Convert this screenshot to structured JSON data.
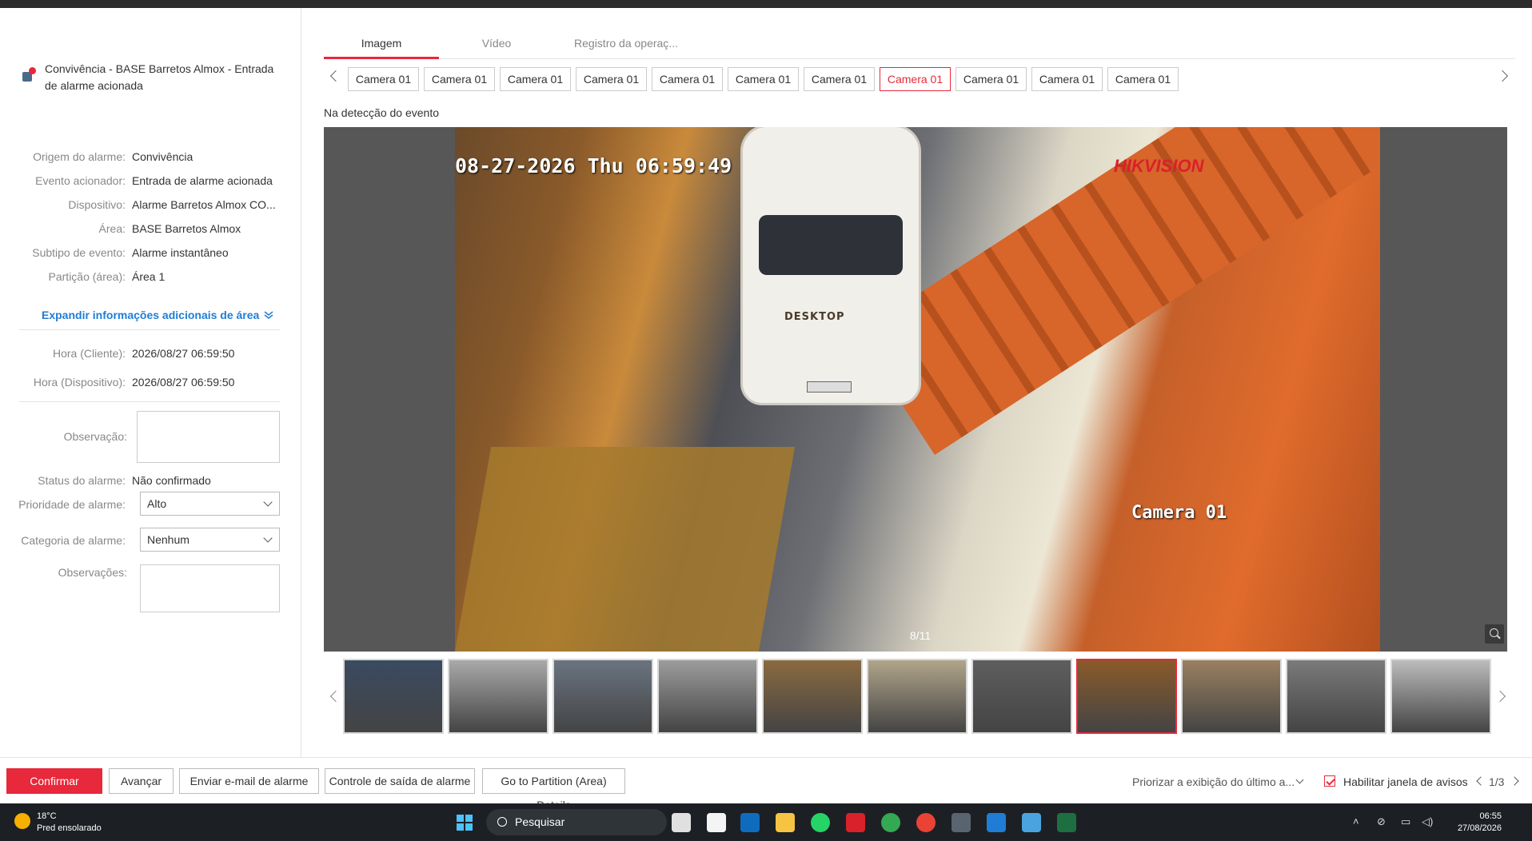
{
  "alarm": {
    "title": "Convivência - BASE Barretos Almox - Entrada de alarme acionada"
  },
  "details": [
    {
      "label": "Origem do alarme:",
      "value": "Convivência"
    },
    {
      "label": "Evento acionador:",
      "value": "Entrada de alarme acionada"
    },
    {
      "label": "Dispositivo:",
      "value": "Alarme Barretos Almox CO..."
    },
    {
      "label": "Área:",
      "value": "BASE Barretos Almox"
    },
    {
      "label": "Subtipo de evento:",
      "value": "Alarme instantâneo"
    },
    {
      "label": "Partição (área):",
      "value": "Área 1"
    }
  ],
  "expand_link": "Expandir informações adicionais de área",
  "times": [
    {
      "label": "Hora (Cliente):",
      "value": "2026/08/27 06:59:50"
    },
    {
      "label": "Hora (Dispositivo):",
      "value": "2026/08/27 06:59:50"
    }
  ],
  "form": {
    "observacao_label": "Observação:",
    "status_label": "Status do alarme:",
    "status_value": "Não confirmado",
    "priority_label": "Prioridade de alarme:",
    "priority_value": "Alto",
    "category_label": "Categoria de alarme:",
    "category_value": "Nenhum",
    "observacoes_label": "Observações:"
  },
  "tabs": [
    "Imagem",
    "Vídeo",
    "Registro da operaç..."
  ],
  "cameras": [
    "Camera 01",
    "Camera 01",
    "Camera 01",
    "Camera 01",
    "Camera 01",
    "Camera 01",
    "Camera 01",
    "Camera 01",
    "Camera 01",
    "Camera 01",
    "Camera 01"
  ],
  "active_camera_index": 7,
  "event_caption": "Na detecção do evento",
  "video": {
    "timestamp": "08-27-2026 Thu 06:59:49",
    "camera_name": "Camera 01",
    "brand": "HIKVISION",
    "car_brand": "DESKTOP",
    "counter": "8/11"
  },
  "thumbnails": {
    "count": 11,
    "active_index": 7,
    "colors": [
      "#3a4a60",
      "#a9a9a9",
      "#6a7480",
      "#9c9c9c",
      "#8a6a40",
      "#b0a58a",
      "#5e5e5e",
      "#8a5a2a",
      "#9a8060",
      "#7a7a7a",
      "#bcbcbc"
    ]
  },
  "actions": {
    "confirm": "Confirmar",
    "advance": "Avançar",
    "email": "Enviar e-mail de alarme",
    "output": "Controle de saída de alarme",
    "partition": "Go to Partition (Area) Details",
    "priority_display": "Priorizar a exibição do último a...",
    "enable_popup": "Habilitar janela de avisos",
    "pager": "1/3"
  },
  "taskbar": {
    "temperature": "18°C",
    "weather": "Pred ensolarado",
    "search_placeholder": "Pesquisar",
    "time": "06:55",
    "date": "27/08/2026"
  },
  "colors": {
    "accent": "#e8283b",
    "link": "#1f7dd6"
  }
}
